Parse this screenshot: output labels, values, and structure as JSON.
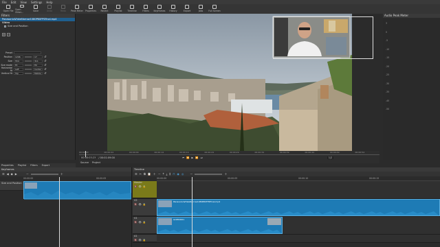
{
  "menu": [
    "File",
    "Edit",
    "View",
    "Settings",
    "Help"
  ],
  "toolbar": [
    {
      "label": "Open File",
      "enabled": true
    },
    {
      "label": "Open Other...",
      "enabled": true
    },
    {
      "label": "Save",
      "enabled": true
    },
    {
      "label": "Undo",
      "enabled": false
    },
    {
      "label": "Redo",
      "enabled": false
    },
    {
      "label": "Peak Meter",
      "enabled": true
    },
    {
      "label": "Properties",
      "enabled": true
    },
    {
      "label": "Recent",
      "enabled": true
    },
    {
      "label": "Playlist",
      "enabled": true
    },
    {
      "label": "Timeline",
      "enabled": true
    },
    {
      "label": "Filters",
      "enabled": true
    },
    {
      "label": "Keyframes",
      "enabled": true
    },
    {
      "label": "History",
      "enabled": true
    },
    {
      "label": "Export",
      "enabled": true
    },
    {
      "label": "Jobs",
      "enabled": true
    },
    {
      "label": "Full Screen",
      "enabled": true
    }
  ],
  "filters": {
    "title": "Filters",
    "clip_name": "Panasonic&FakeNarrow1080P60FPSFinal.mp4",
    "category": "Video",
    "filter_item": "Size and Position",
    "preset_label": "Preset",
    "props": [
      {
        "label": "Position",
        "a": "1296",
        "b": "17"
      },
      {
        "label": "Size",
        "a": "554",
        "b": "311"
      },
      {
        "label": "Size mode",
        "a": "Fit",
        "b": "Fill"
      },
      {
        "label": "Horizontal fit",
        "a": "Left",
        "b": "Center"
      },
      {
        "label": "Vertical fit",
        "a": "Top",
        "b": "Middle"
      }
    ],
    "extras": [
      "Distort",
      "Right",
      "Bottom"
    ]
  },
  "audio_title": "Audio Peak Meter",
  "audio_scale": [
    "3",
    "0",
    "-5",
    "-10",
    "-15",
    "-20",
    "-25",
    "-30",
    "-35",
    "-40",
    "-50"
  ],
  "preview": {
    "ruler": [
      "00:00:00",
      "00:00:04",
      "00:00:09",
      "00:00:14",
      "00:00:19",
      "00:00:24",
      "00:00:29",
      "00:00:34",
      "00:00:39",
      "00:00:44",
      "00:00:49",
      "00:00:54"
    ],
    "timecode_current": "00:00:03:23",
    "timecode_total": "/ 00:01:09:00",
    "zoom_label": "1/2",
    "source_tab": "Source",
    "project_tab": "Project"
  },
  "left_tabs": [
    "Properties",
    "Playlist",
    "Filters",
    "Export"
  ],
  "right_tabs": [
    "Source",
    "Project"
  ],
  "keyframes": {
    "title": "Keyframes",
    "track_label": "Size and Position",
    "ruler": [
      "00:00:00",
      "00:00:05"
    ]
  },
  "timeline": {
    "title": "Timeline",
    "ruler": [
      "00:00:00",
      "00:00:05",
      "00:00:10",
      "00:00:15",
      "00:00:20"
    ],
    "tracks": [
      {
        "name": "Master"
      },
      {
        "name": "V2"
      },
      {
        "name": "V1"
      },
      {
        "name": "A1"
      }
    ],
    "clip_v2_label": "Panasonic&FakeNarrow1080P60FPSFinal.mp4",
    "clip_v1_label": "GOPR0001",
    "master_color": "#7a7a1a",
    "clip_color": "#1e7bb5"
  }
}
